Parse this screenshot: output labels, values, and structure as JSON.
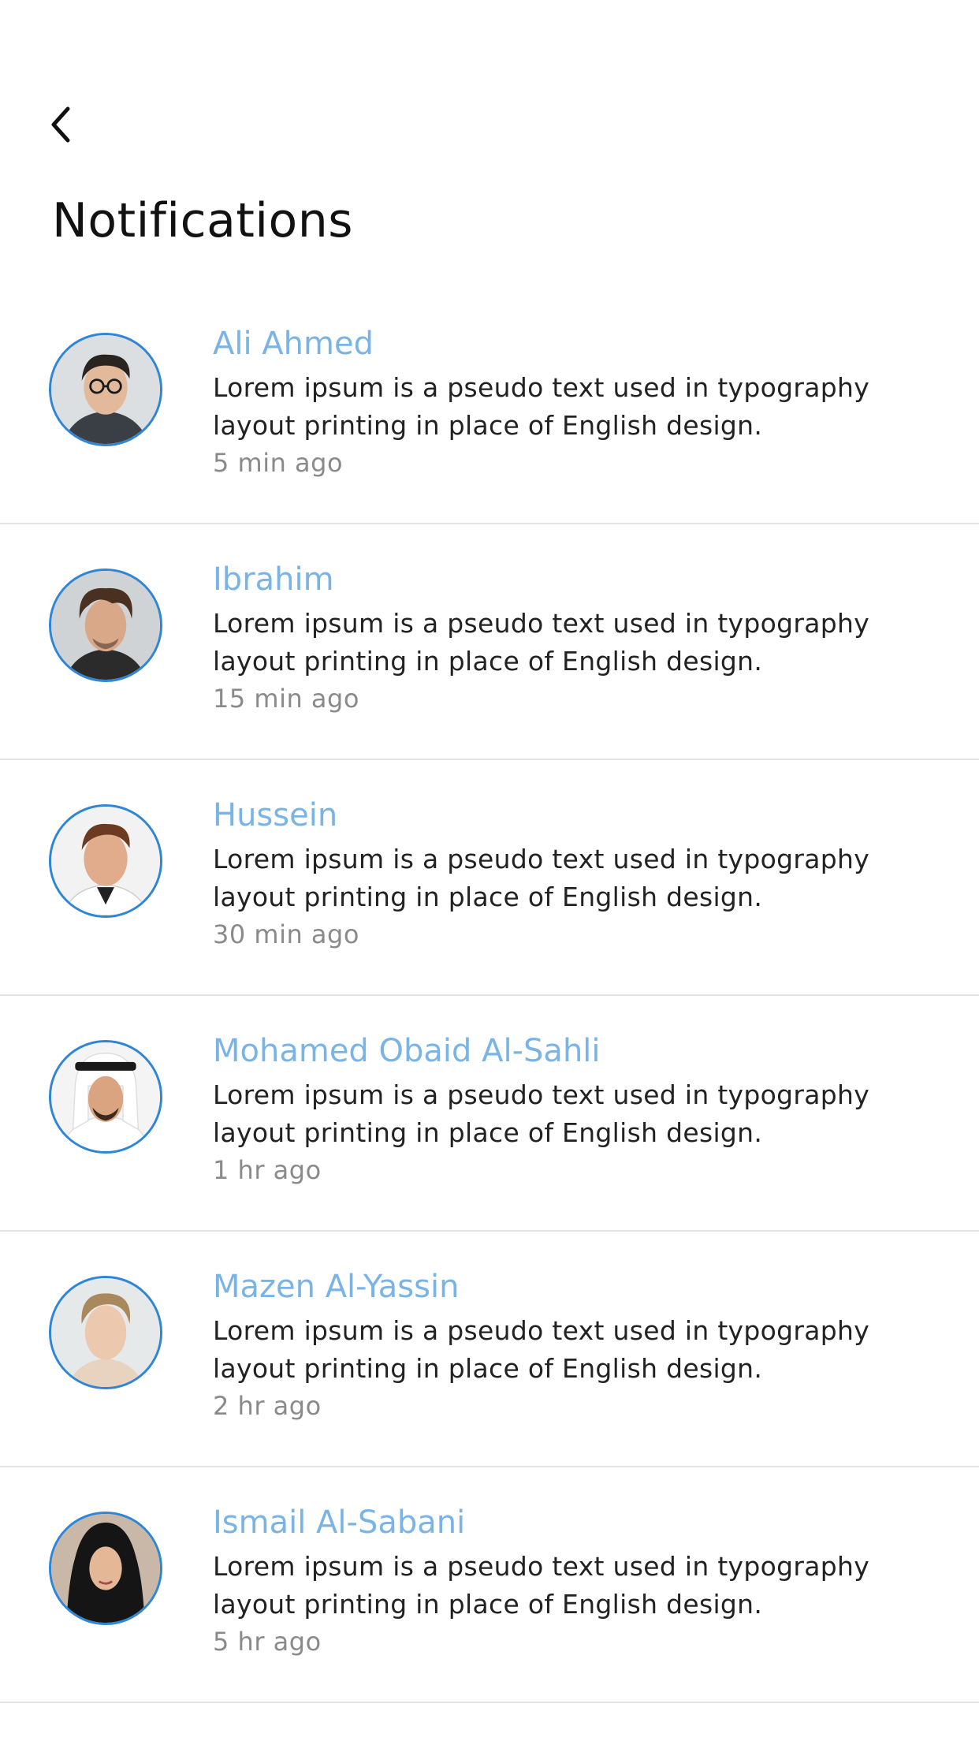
{
  "header": {
    "back_icon": "chevron-left-icon",
    "title": "Notifications"
  },
  "colors": {
    "accent": "#7ab4e6",
    "avatar_border": "#2f86d6",
    "divider": "#e4e4e4",
    "time_text": "#8a8a8a"
  },
  "notifications": [
    {
      "name": "Ali Ahmed",
      "message": "Lorem ipsum is a pseudo text used in typography layout printing in place of English design.",
      "time": "5 min ago"
    },
    {
      "name": "Ibrahim",
      "message": "Lorem ipsum is a pseudo text used in typography layout printing in place of English design.",
      "time": "15 min ago"
    },
    {
      "name": "Hussein",
      "message": "Lorem ipsum is a pseudo text used in typography layout printing in place of English design.",
      "time": "30 min ago"
    },
    {
      "name": "Mohamed Obaid Al-Sahli",
      "message": "Lorem ipsum is a pseudo text used in typography layout printing in place of English design.",
      "time": "1 hr ago"
    },
    {
      "name": "Mazen Al-Yassin",
      "message": "Lorem ipsum is a pseudo text used in typography layout printing in place of English design.",
      "time": "2 hr ago"
    },
    {
      "name": "Ismail Al-Sabani",
      "message": "Lorem ipsum is a pseudo text used in typography layout printing in place of English design.",
      "time": "5 hr ago"
    }
  ]
}
